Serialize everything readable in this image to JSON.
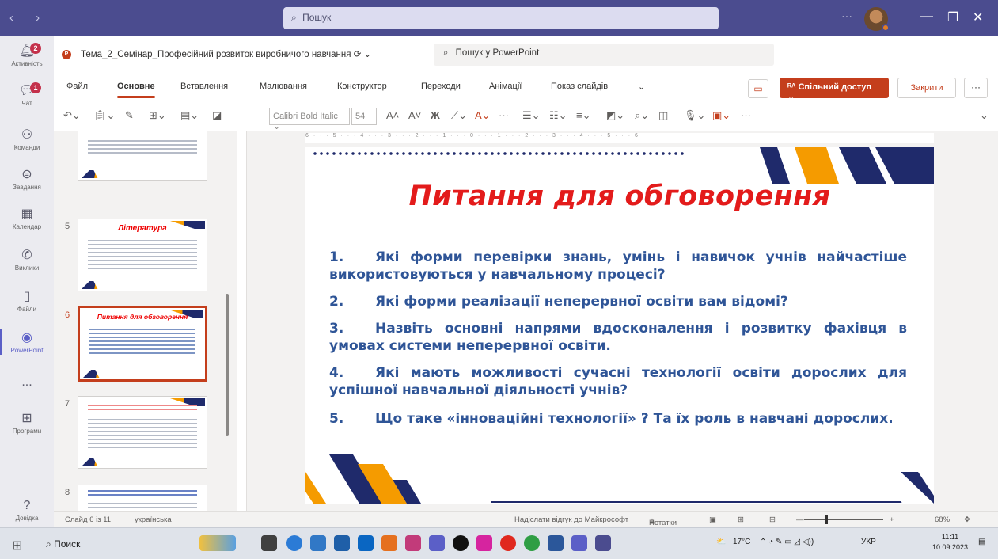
{
  "teams": {
    "search_placeholder": "Пошук",
    "rail": [
      {
        "label": "Активність",
        "icon": "bell-icon",
        "badge": "2"
      },
      {
        "label": "Чат",
        "icon": "chat-icon",
        "badge": "1"
      },
      {
        "label": "Команди",
        "icon": "teams-icon"
      },
      {
        "label": "Завдання",
        "icon": "assignments-icon"
      },
      {
        "label": "Календар",
        "icon": "calendar-icon"
      },
      {
        "label": "Виклики",
        "icon": "phone-icon"
      },
      {
        "label": "Файли",
        "icon": "file-icon"
      },
      {
        "label": "PowerPoint",
        "icon": "powerpoint-icon"
      },
      {
        "label": "...",
        "icon": "more-icon"
      },
      {
        "label": "Програми",
        "icon": "apps-icon"
      },
      {
        "label": "Довідка",
        "icon": "help-icon"
      }
    ]
  },
  "ppt": {
    "filename": "Тема_2_Семінар_Професійний розвиток виробничого навчання",
    "search_label": "Пошук у PowerPoint",
    "tabs": [
      "Файл",
      "Основне",
      "Вставлення",
      "Малювання",
      "Конструктор",
      "Переходи",
      "Анімації",
      "Показ слайдів"
    ],
    "active_tab": "Основне",
    "share_label": "Спільний доступ",
    "close_label": "Закрити",
    "font_name": "Calibri Bold Italic",
    "font_size": "54",
    "ruler_text": "6 · · · 5 · · · 4 · · · 3 · · · 2 · · · 1 · · · 0 · · · 1 · · · 2 · · · 3 · · · 4 · · · 5 · · · 6",
    "thumbnails": [
      {
        "num": "",
        "title": ""
      },
      {
        "num": "5",
        "title": "Література"
      },
      {
        "num": "6",
        "title": "Питання для обговорення"
      },
      {
        "num": "7",
        "title": ""
      },
      {
        "num": "8",
        "title": ""
      }
    ],
    "slide": {
      "title": "Питання для обговорення",
      "questions": [
        {
          "num": "1.",
          "text": "Які форми перевірки знань, умінь і навичок учнів найчастіше використовуються у навчальному процесі?"
        },
        {
          "num": "2.",
          "text": "Які форми реалізації неперервної освіти вам відомі?"
        },
        {
          "num": "3.",
          "text": "Назвіть основні напрями вдосконалення і розвитку фахівця в умовах системи неперервної освіти."
        },
        {
          "num": "4.",
          "text": "Які мають можливості сучасні технології освіти дорослих для успішної навчальної діяльності учнів?"
        },
        {
          "num": "5.",
          "text": "Що таке «інноваційні технології» ? Та їх роль в навчані дорослих."
        }
      ]
    },
    "status": {
      "slide_info": "Слайд 6 із 11",
      "language": "українська",
      "feedback": "Надіслати відгук до Майкрософт",
      "notes": "Нотатки",
      "zoom": "68%"
    }
  },
  "taskbar": {
    "search": "Поиск",
    "weather": "17°C",
    "lang": "УКР",
    "time": "11:11",
    "date": "10.09.2023"
  },
  "colors": {
    "teams_header": "#4b4c8f",
    "ppt_accent": "#c43e1c",
    "slide_title": "#e31b1b",
    "slide_text": "#2f5597",
    "deco_navy": "#1f2a6b",
    "deco_orange": "#f59b00"
  }
}
